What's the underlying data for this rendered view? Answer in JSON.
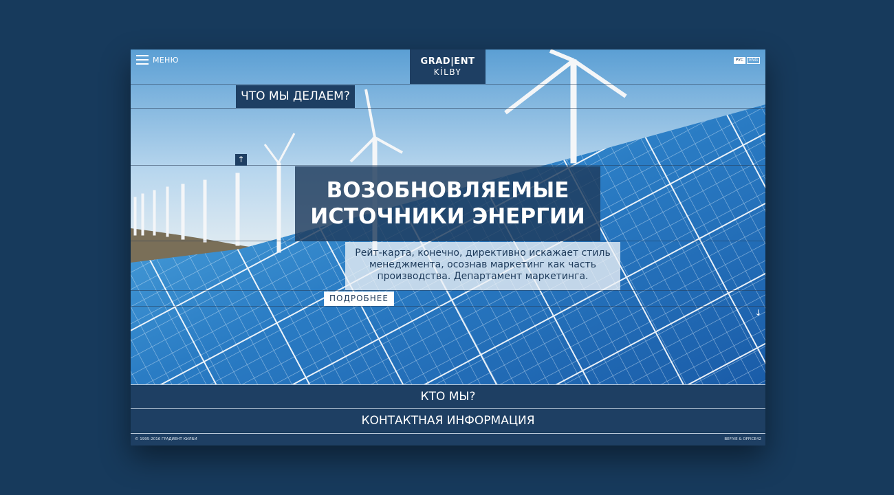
{
  "header": {
    "menu_label": "МЕНЮ",
    "logo_line1": "GRAD|ENT",
    "logo_line2": "KİLBY",
    "lang": [
      "РУС",
      "ENG"
    ]
  },
  "hero": {
    "section_tab": "ЧТО МЫ ДЕЛАЕМ?",
    "headline": "ВОЗОБНОВЛЯЕМЫЕ ИСТОЧНИКИ ЭНЕРГИИ",
    "lead": "Рейт-карта, конечно, директивно искажает стиль менеджмента, осознав маркетинг как часть производства. Департамент маркетинга.",
    "more_button": "ПОДРОБНЕЕ",
    "arrow_up": "↑",
    "arrow_down": "↓"
  },
  "nav": {
    "who": "КТО МЫ?",
    "contacts": "КОНТАКТНАЯ ИНФОРМАЦИЯ"
  },
  "footer": {
    "copyright": "© 1995-2016 ГРАДИЕНТ КИЛБИ",
    "developer": "BEFIVE & OFFICE42"
  },
  "colors": {
    "page_bg": "#173a5c",
    "panel": "#1e3f63",
    "text_light": "#ffffff"
  }
}
